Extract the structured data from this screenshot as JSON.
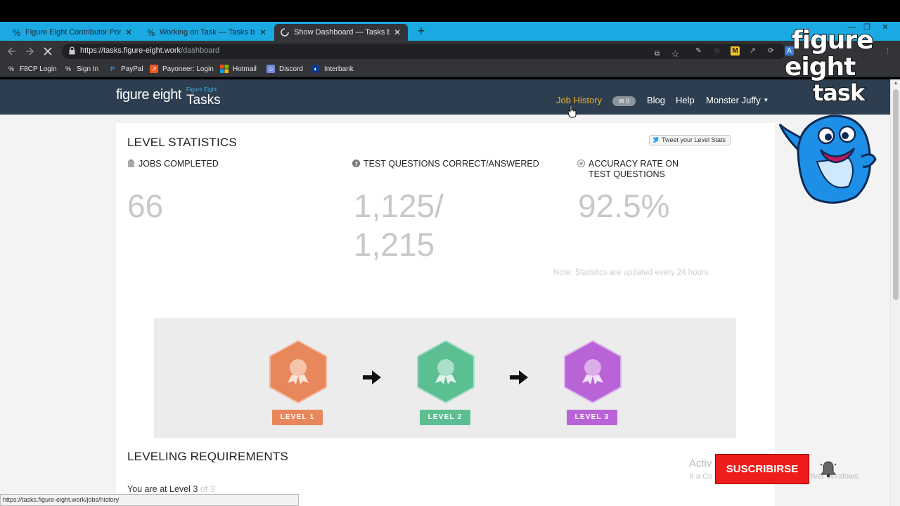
{
  "browser": {
    "tabs": [
      {
        "label": "Figure Eight Contributor Portal",
        "close": "✕"
      },
      {
        "label": "Working on Task — Tasks by Fig",
        "close": "✕"
      },
      {
        "label": "Show Dashboard — Tasks by Fig",
        "close": "✕"
      }
    ],
    "new_tab": "+",
    "window_controls": [
      "—",
      "❐",
      "✕"
    ],
    "url": {
      "host": "https://tasks.figure-eight.work",
      "path": "/dashboard"
    },
    "bookmarks": [
      "F8CP Login",
      "Sign In",
      "PayPal",
      "Payoneer: Login",
      "Hotmail",
      "Discord",
      "Interbank"
    ],
    "status_url": "https://tasks.figure-eight.work/jobs/history"
  },
  "site": {
    "logo": "figure eight",
    "logo_sub": "Figure Eight",
    "logo_product": "Tasks",
    "nav": {
      "job_history": "Job History",
      "messages_count": "0",
      "blog": "Blog",
      "help": "Help",
      "user": "Monster Juffy"
    }
  },
  "stats": {
    "title": "LEVEL STATISTICS",
    "tweet": "Tweet your Level Stats",
    "jobs_label": "JOBS COMPLETED",
    "jobs_value": "66",
    "tq_label": "TEST QUESTIONS CORRECT/ANSWERED",
    "tq_value_line1": "1,125/",
    "tq_value_line2": "1,215",
    "acc_label_line1": "ACCURACY RATE ON",
    "acc_label_line2": "TEST QUESTIONS",
    "acc_value": "92.5%",
    "note": "Note: Statistics are updated every 24 hours"
  },
  "levels": [
    {
      "label": "LEVEL 1",
      "color": "#e8875a"
    },
    {
      "label": "LEVEL 2",
      "color": "#5cbf92"
    },
    {
      "label": "LEVEL 3",
      "color": "#b964d6"
    }
  ],
  "requirements": {
    "title": "LEVELING REQUIREMENTS",
    "current_prefix": "You are at Level 3",
    "current_suffix": " of 3"
  },
  "overlay": {
    "watermark": [
      "figure",
      "eight",
      "task"
    ],
    "subscribe": "SUSCRIBIRSE",
    "activate_title": "Activ",
    "activate_sub": "Ir a Co",
    "activate_sub2": "tivar Windows."
  }
}
